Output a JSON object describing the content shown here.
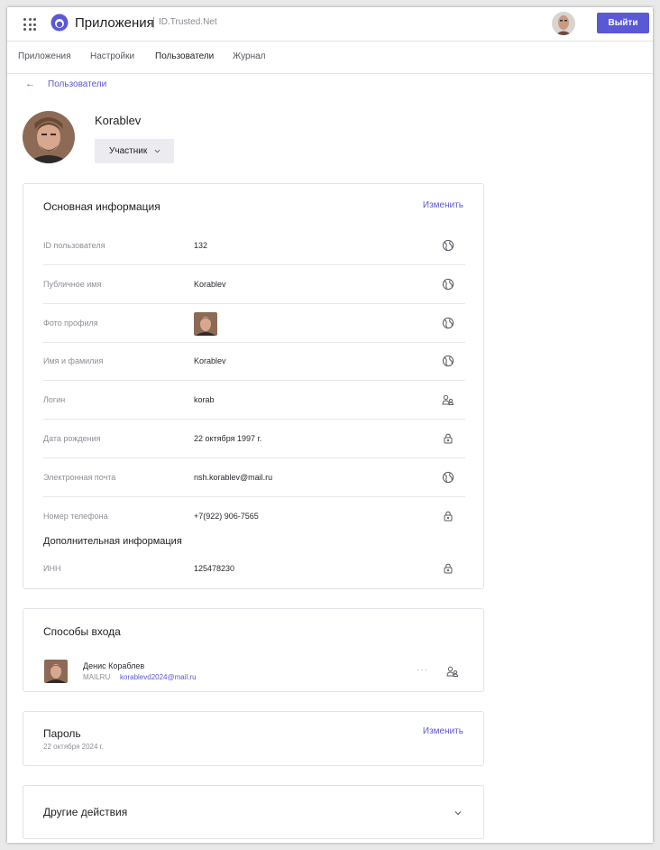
{
  "header": {
    "app_title": "Приложения",
    "brand": "ID.Trusted.Net",
    "logout_label": "Выйти"
  },
  "icons": {
    "apps": "apps-grid-icon",
    "logo": "logo-icon",
    "back": "arrow-left-icon",
    "public": "globe-icon",
    "shared": "users-icon",
    "private": "lock-icon",
    "more": "more-dots-icon",
    "expand": "chevron-down-icon"
  },
  "colors": {
    "accent": "#5b58d6"
  },
  "nav": {
    "tabs": [
      {
        "label": "Приложения",
        "active": false
      },
      {
        "label": "Настройки",
        "active": false
      },
      {
        "label": "Пользователи",
        "active": true
      },
      {
        "label": "Журнал",
        "active": false
      }
    ]
  },
  "breadcrumb": {
    "label": "Пользователи"
  },
  "profile": {
    "name": "Korablev",
    "role": "Участник"
  },
  "basic_info": {
    "title": "Основная информация",
    "edit_label": "Изменить",
    "rows": [
      {
        "label": "ID пользователя",
        "value": "132",
        "icon": "globe-icon"
      },
      {
        "label": "Публичное имя",
        "value": "Korablev",
        "icon": "globe-icon"
      },
      {
        "label": "Фото профиля",
        "value": "",
        "icon": "globe-icon"
      },
      {
        "label": "Имя и фамилия",
        "value": "Korablev",
        "icon": "globe-icon"
      },
      {
        "label": "Логин",
        "value": "korab",
        "icon": "users-icon"
      },
      {
        "label": "Дата рождения",
        "value": "22 октября 1997 г.",
        "icon": "lock-icon"
      },
      {
        "label": "Электронная почта",
        "value": "nsh.korablev@mail.ru",
        "icon": "globe-icon"
      },
      {
        "label": "Номер телефона",
        "value": "+7(922) 906-7565",
        "icon": "lock-icon"
      }
    ],
    "extra_title": "Дополнительная информация",
    "extra_rows": [
      {
        "label": "ИНН",
        "value": "125478230",
        "icon": "lock-icon"
      }
    ]
  },
  "login_methods": {
    "title": "Способы входа",
    "items": [
      {
        "name": "Денис Кораблев",
        "provider": "MAILRU",
        "email": "korablevd2024@mail.ru",
        "more": "···"
      }
    ]
  },
  "password": {
    "title": "Пароль",
    "date": "22 октября 2024 г.",
    "edit_label": "Изменить"
  },
  "other_actions": {
    "title": "Другие действия"
  }
}
